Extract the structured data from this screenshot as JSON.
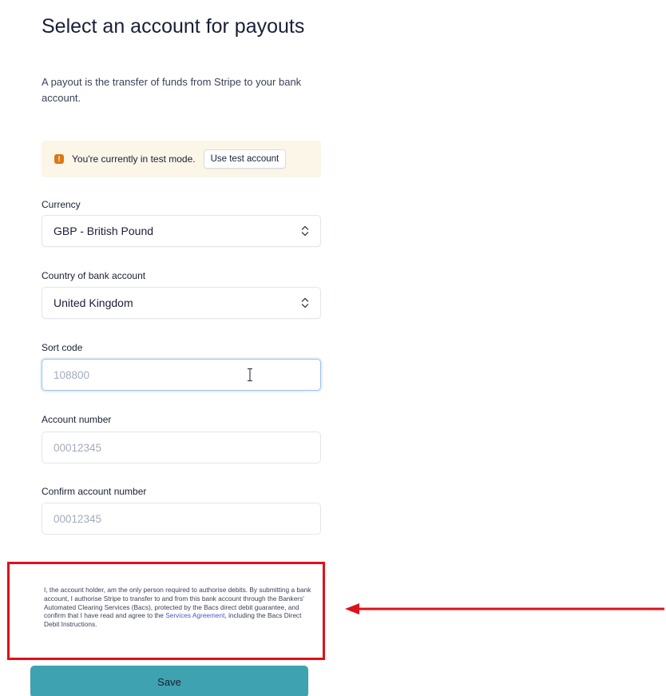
{
  "header": {
    "title": "Select an account for payouts",
    "subtitle": "A payout is the transfer of funds from Stripe to your bank account."
  },
  "test_banner": {
    "icon": "warning-icon",
    "message": "You're currently in test mode.",
    "button_label": "Use test account"
  },
  "form": {
    "currency": {
      "label": "Currency",
      "value": "GBP - British Pound"
    },
    "country": {
      "label": "Country of bank account",
      "value": "United Kingdom"
    },
    "sort_code": {
      "label": "Sort code",
      "placeholder": "108800"
    },
    "account_number": {
      "label": "Account number",
      "placeholder": "00012345"
    },
    "confirm_account_number": {
      "label": "Confirm account number",
      "placeholder": "00012345"
    }
  },
  "legal": {
    "text_before": "I, the account holder, am the only person required to authorise debits. By submitting a bank account, I authorise Stripe to transfer to and from this bank account through the Bankers' Automated Clearing Services (Bacs), protected by the Bacs direct debit guarantee, and confirm that I have read and agree to the ",
    "link_text": "Services Agreement",
    "text_after": ", including the Bacs Direct Debit Instructions."
  },
  "save_label": "Save",
  "colors": {
    "annotation": "#e0101a",
    "primary_button": "#3fa2b0",
    "link": "#4a55c6",
    "banner_bg": "#fbf6e7"
  }
}
